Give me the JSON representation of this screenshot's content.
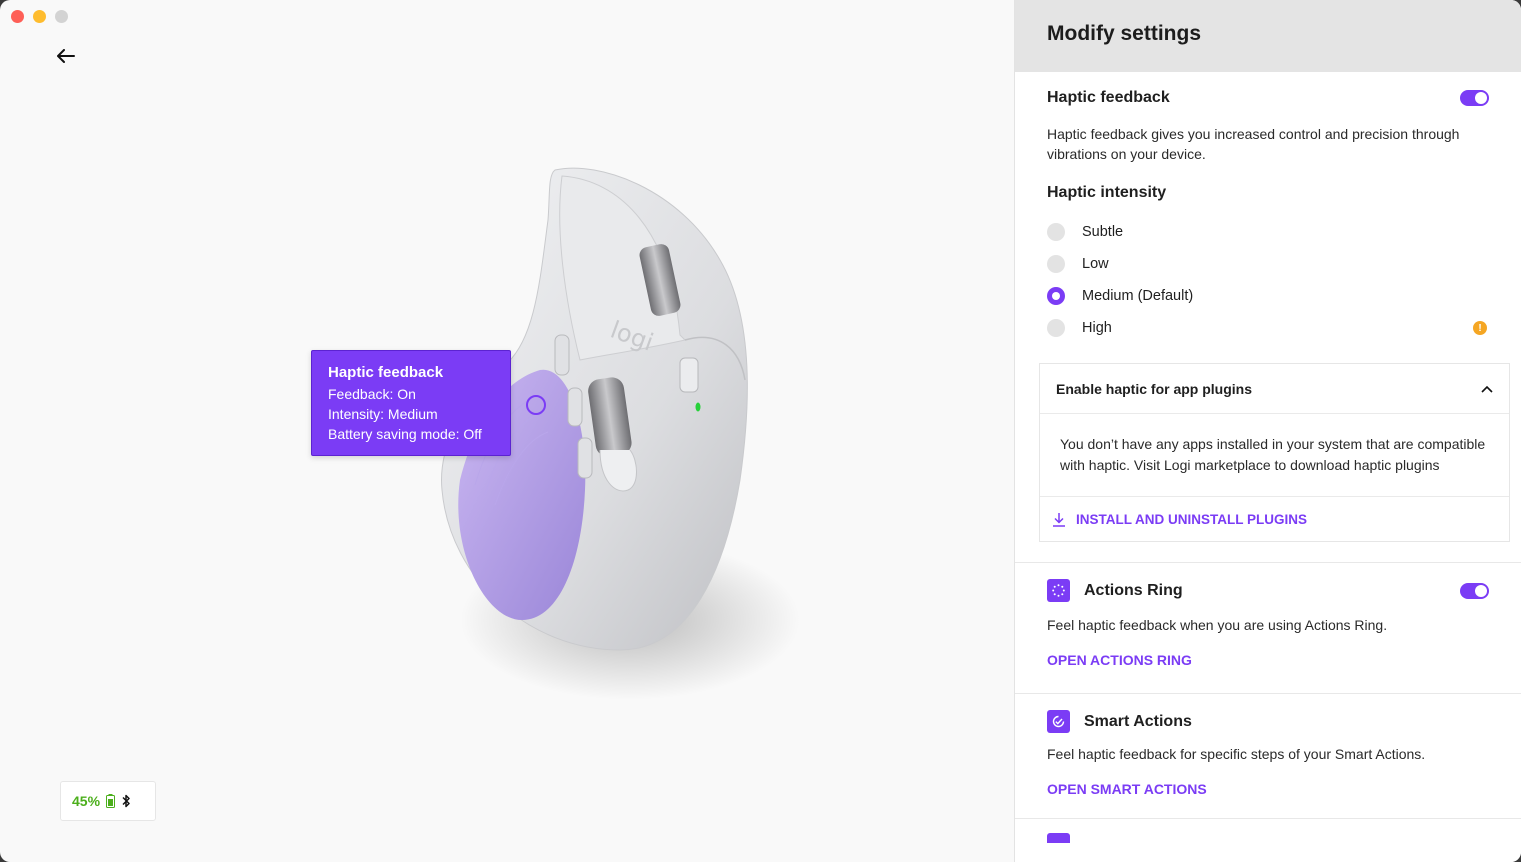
{
  "panel": {
    "title": "Modify settings",
    "haptic": {
      "title": "Haptic feedback",
      "enabled": true,
      "description": "Haptic feedback gives you increased control and precision through vibrations on your device.",
      "intensity_title": "Haptic intensity",
      "options": [
        {
          "label": "Subtle",
          "selected": false
        },
        {
          "label": "Low",
          "selected": false
        },
        {
          "label": "Medium (Default)",
          "selected": true
        },
        {
          "label": "High",
          "selected": false
        }
      ],
      "warning_icon": "warning-icon"
    },
    "plugins": {
      "title": "Enable haptic for app plugins",
      "expanded": true,
      "message": "You don’t have any apps installed in your system that are compatible with haptic. Visit Logi marketplace to download haptic plugins",
      "link": "INSTALL AND UNINSTALL PLUGINS"
    },
    "actions_ring": {
      "title": "Actions Ring",
      "enabled": true,
      "description": "Feel haptic feedback when you are using Actions Ring.",
      "link": "OPEN ACTIONS RING"
    },
    "smart_actions": {
      "title": "Smart Actions",
      "description": "Feel haptic feedback for specific steps of your Smart Actions.",
      "link": "OPEN SMART ACTIONS"
    }
  },
  "tooltip": {
    "title": "Haptic feedback",
    "feedback": "Feedback: On",
    "intensity": "Intensity: Medium",
    "battery_saving": "Battery saving mode: Off"
  },
  "device": {
    "battery_percent": "45%",
    "brand_mark": "logi"
  },
  "colors": {
    "accent": "#7b3cf5",
    "battery": "#4caf1c",
    "warning": "#f5a623"
  }
}
